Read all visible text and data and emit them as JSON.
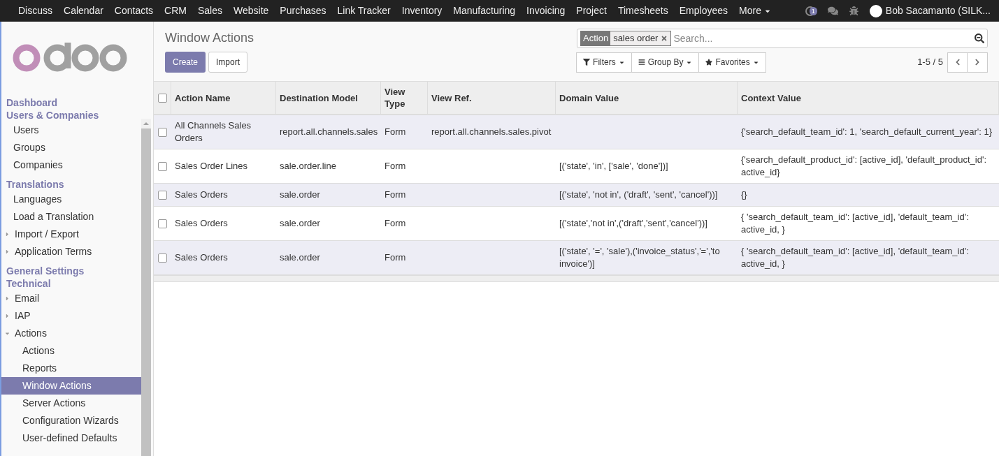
{
  "top_menu": [
    {
      "label": "Discuss"
    },
    {
      "label": "Calendar"
    },
    {
      "label": "Contacts"
    },
    {
      "label": "CRM"
    },
    {
      "label": "Sales"
    },
    {
      "label": "Website"
    },
    {
      "label": "Purchases"
    },
    {
      "label": "Link Tracker"
    },
    {
      "label": "Inventory"
    },
    {
      "label": "Manufacturing"
    },
    {
      "label": "Invoicing"
    },
    {
      "label": "Project"
    },
    {
      "label": "Timesheets"
    },
    {
      "label": "Employees"
    }
  ],
  "more_menu": "More",
  "systray": {
    "badge": "1",
    "user": "Bob Sacamanto (SILK..."
  },
  "sidebar": [
    {
      "kind": "header",
      "label": "Dashboard"
    },
    {
      "kind": "header",
      "label": "Users & Companies"
    },
    {
      "kind": "leaf",
      "label": "Users",
      "selected": false
    },
    {
      "kind": "leaf",
      "label": "Groups",
      "selected": false
    },
    {
      "kind": "leaf",
      "label": "Companies",
      "selected": false
    },
    {
      "kind": "header",
      "label": "Translations"
    },
    {
      "kind": "leaf",
      "label": "Languages",
      "selected": false
    },
    {
      "kind": "leaf",
      "label": "Load a Translation",
      "selected": false
    },
    {
      "kind": "folder",
      "label": "Import / Export",
      "expanded": false
    },
    {
      "kind": "folder",
      "label": "Application Terms",
      "expanded": false
    },
    {
      "kind": "header",
      "label": "General Settings"
    },
    {
      "kind": "header",
      "label": "Technical"
    },
    {
      "kind": "folder",
      "label": "Email",
      "expanded": false
    },
    {
      "kind": "folder",
      "label": "IAP",
      "expanded": false
    },
    {
      "kind": "folder",
      "label": "Actions",
      "expanded": true,
      "children": [
        {
          "label": "Actions",
          "selected": false
        },
        {
          "label": "Reports",
          "selected": false
        },
        {
          "label": "Window Actions",
          "selected": true
        },
        {
          "label": "Server Actions",
          "selected": false
        },
        {
          "label": "Configuration Wizards",
          "selected": false
        },
        {
          "label": "User-defined Defaults",
          "selected": false
        }
      ]
    }
  ],
  "breadcrumb": "Window Actions",
  "buttons": {
    "create": "Create",
    "import": "Import"
  },
  "search": {
    "facet_label": "Action",
    "facet_value": "sales order",
    "placeholder": "Search..."
  },
  "filters": [
    {
      "kind": "filter",
      "label": "Filters"
    },
    {
      "kind": "group",
      "label": "Group By"
    },
    {
      "kind": "star",
      "label": "Favorites"
    }
  ],
  "pager": "1-5 / 5",
  "table": {
    "select_all": false,
    "columns": [
      "Action Name",
      "Destination Model",
      "View Type",
      "View Ref.",
      "Domain Value",
      "Context Value"
    ],
    "rows": [
      {
        "checked": false,
        "cells": [
          "All Channels Sales Orders",
          "report.all.channels.sales",
          "Form",
          "report.all.channels.sales.pivot",
          "",
          "{'search_default_team_id': 1, 'search_default_current_year': 1}"
        ]
      },
      {
        "checked": false,
        "cells": [
          "Sales Order Lines",
          "sale.order.line",
          "Form",
          "",
          "[('state', 'in', ['sale', 'done'])]",
          "{'search_default_product_id': [active_id], 'default_product_id': active_id}"
        ]
      },
      {
        "checked": false,
        "cells": [
          "Sales Orders",
          "sale.order",
          "Form",
          "",
          "[('state', 'not in', ('draft', 'sent', 'cancel'))]",
          "{}"
        ]
      },
      {
        "checked": false,
        "cells": [
          "Sales Orders",
          "sale.order",
          "Form",
          "",
          "[('state','not in',('draft','sent','cancel'))]",
          "{ 'search_default_team_id': [active_id], 'default_team_id': active_id, }"
        ]
      },
      {
        "checked": false,
        "cells": [
          "Sales Orders",
          "sale.order",
          "Form",
          "",
          "[('state', '=', 'sale'),('invoice_status','=','to invoice')]",
          "{ 'search_default_team_id': [active_id], 'default_team_id': active_id, }"
        ]
      }
    ]
  }
}
